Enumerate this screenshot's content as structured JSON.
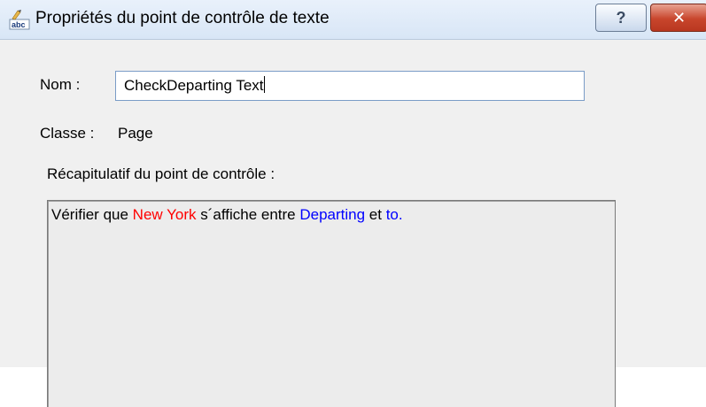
{
  "window": {
    "title": "Propriétés du point de contrôle de texte",
    "help_label": "?",
    "close_label": "✕"
  },
  "form": {
    "name_label": "Nom :",
    "name_value": "CheckDeparting Text",
    "class_label": "Classe :",
    "class_value": "Page",
    "summary_label": "Récapitulatif du point de contrôle :"
  },
  "summary": {
    "prefix": "Vérifier que ",
    "value": "New York",
    "middle": " s´affiche entre ",
    "start_anchor": "Departing",
    "conjunction": " et  ",
    "end_anchor": "to."
  },
  "colors": {
    "value_text": "#ff0000",
    "anchor_text": "#0000ff"
  },
  "icons": {
    "app": "abc-checkpoint-icon"
  }
}
